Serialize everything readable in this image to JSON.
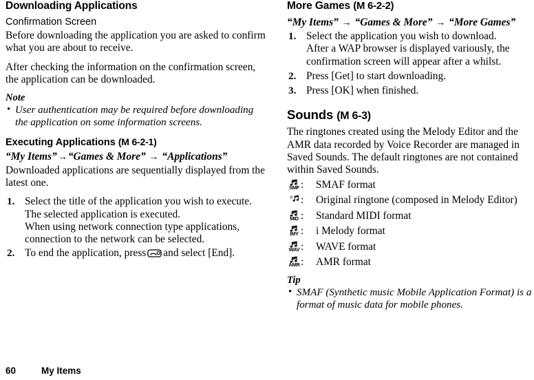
{
  "page": {
    "footer": {
      "page_number": "60",
      "section_name": "My Items"
    }
  },
  "left_column": {
    "heading": "Downloading Applications",
    "confirmation": {
      "subheading": "Confirmation Screen",
      "paragraph_1": "Before downloading the application you are asked to confirm what you are about to receive.",
      "paragraph_2": "After checking the information on the confirmation screen, the application can be downloaded."
    },
    "note": {
      "title": "Note",
      "items": [
        "User authentication may be required before downloading the application on some information screens."
      ]
    },
    "executing": {
      "heading": "Executing Applications",
      "menu_ref": "(M 6-2-1)",
      "path": {
        "part_1": "“My Items”",
        "arrow_1": "→",
        "part_2": "“Games & More”",
        "arrow_2": "→",
        "part_3": "“Applications”"
      },
      "intro": "Downloaded applications are sequentially displayed from the latest one.",
      "steps": [
        {
          "number": "1.",
          "text": "Select the title of the application you wish to execute.",
          "sublines": [
            "The selected application is executed.",
            "When using network connection type applications, connection to the network can be selected."
          ]
        },
        {
          "number": "2.",
          "text_before_icon": "To end the application, press",
          "icon": "end-call-key-icon",
          "text_after_icon": "and select [End]."
        }
      ]
    }
  },
  "right_column": {
    "more_games": {
      "heading": "More Games",
      "menu_ref": "(M 6-2-2)",
      "path": {
        "part_1": "“My Items”",
        "arrow_1": "→",
        "part_2": "“Games & More”",
        "arrow_2": "→",
        "part_3": "“More Games”"
      },
      "steps": [
        {
          "number": "1.",
          "text": "Select the application you wish to download.",
          "sublines": [
            "After a WAP browser is displayed variously, the confirmation screen will appear after a whilst."
          ]
        },
        {
          "number": "2.",
          "text": "Press [Get] to start downloading.",
          "sublines": []
        },
        {
          "number": "3.",
          "text": "Press [OK] when finished.",
          "sublines": []
        }
      ]
    },
    "sounds": {
      "heading": "Sounds",
      "menu_ref": "(M 6-3)",
      "paragraph": "The ringtones created using the Melody Editor and the AMR data recorded by Voice Recorder are managed in Saved Sounds. The default ringtones are not contained within Saved Sounds.",
      "formats": [
        {
          "icon": "smaf-format-icon",
          "icon_text": "SMF",
          "separator": ":",
          "label": "SMAF format"
        },
        {
          "icon": "original-ringtone-icon",
          "icon_text": "",
          "separator": ":",
          "label": "Original ringtone (composed in Melody Editor)"
        },
        {
          "icon": "midi-format-icon",
          "icon_text": "MID",
          "separator": ":",
          "label": "Standard MIDI format"
        },
        {
          "icon": "imelody-format-icon",
          "icon_text": "IMY",
          "separator": ":",
          "label": "i Melody format"
        },
        {
          "icon": "wave-format-icon",
          "icon_text": "WAV",
          "separator": ":",
          "label": "WAVE format"
        },
        {
          "icon": "amr-format-icon",
          "icon_text": "AMR",
          "separator": ":",
          "label": "AMR format"
        }
      ],
      "tip": {
        "title": "Tip",
        "items": [
          "SMAF (Synthetic music Mobile Application Format) is a format of music data for mobile phones."
        ]
      }
    }
  }
}
